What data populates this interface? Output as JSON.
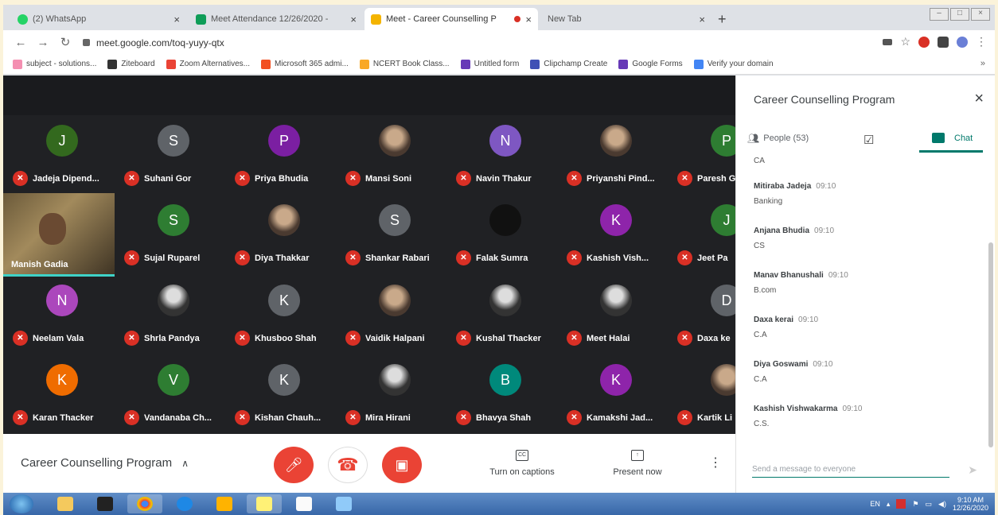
{
  "browser": {
    "tabs": [
      {
        "title": "(2) WhatsApp",
        "favicon_color": "#25d366",
        "active": false
      },
      {
        "title": "Meet Attendance 12/26/2020 - ",
        "favicon_color": "#0f9d58",
        "active": false
      },
      {
        "title": "Meet - Career Counselling P",
        "favicon_color": "#f4b400",
        "active": true
      },
      {
        "title": "New Tab",
        "favicon_color": "",
        "active": false
      }
    ],
    "url": "meet.google.com/toq-yuyy-qtx",
    "bookmarks": [
      {
        "label": "subject - solutions...",
        "color": "#f48fb1"
      },
      {
        "label": "Ziteboard",
        "color": "#333333"
      },
      {
        "label": "Zoom Alternatives...",
        "color": "#ea4335"
      },
      {
        "label": "Microsoft 365 admi...",
        "color": "#f25022"
      },
      {
        "label": "NCERT Book Class...",
        "color": "#f9a825"
      },
      {
        "label": "Untitled form",
        "color": "#673ab7"
      },
      {
        "label": "Clipchamp Create",
        "color": "#3f51b5"
      },
      {
        "label": "Google Forms",
        "color": "#673ab7"
      },
      {
        "label": "Verify your domain",
        "color": "#4285f4"
      }
    ],
    "bookmarks_more": "»"
  },
  "meet": {
    "self_tile": {
      "name": "Manish Gadia"
    },
    "participants": [
      {
        "initial": "J",
        "name": "Jadeja Dipend...",
        "color": "#33691e",
        "style": "letter"
      },
      {
        "initial": "S",
        "name": "Suhani Gor",
        "color": "#5f6368",
        "style": "letter"
      },
      {
        "initial": "P",
        "name": "Priya Bhudia",
        "color": "#7b1fa2",
        "style": "letter"
      },
      {
        "initial": "",
        "name": "Mansi Soni",
        "color": "",
        "style": "photo"
      },
      {
        "initial": "N",
        "name": "Navin Thakur",
        "color": "#7e57c2",
        "style": "letter"
      },
      {
        "initial": "",
        "name": "Priyanshi Pind...",
        "color": "",
        "style": "photo"
      },
      {
        "initial": "P",
        "name": "Paresh G",
        "color": "#2e7d32",
        "style": "letter"
      },
      {
        "initial": "S",
        "name": "Sujal Ruparel",
        "color": "#2e7d32",
        "style": "letter"
      },
      {
        "initial": "",
        "name": "Diya Thakkar",
        "color": "",
        "style": "photo"
      },
      {
        "initial": "S",
        "name": "Shankar Rabari",
        "color": "#5f6368",
        "style": "letter"
      },
      {
        "initial": "",
        "name": "Falak Sumra",
        "color": "",
        "style": "dark"
      },
      {
        "initial": "K",
        "name": "Kashish Vish...",
        "color": "#8e24aa",
        "style": "letter"
      },
      {
        "initial": "J",
        "name": "Jeet Pa",
        "color": "#2e7d32",
        "style": "letter"
      },
      {
        "initial": "N",
        "name": "Neelam Vala",
        "color": "#ab47bc",
        "style": "letter"
      },
      {
        "initial": "",
        "name": "Shrla Pandya",
        "color": "",
        "style": "photo2"
      },
      {
        "initial": "K",
        "name": "Khusboo Shah",
        "color": "#5f6368",
        "style": "letter"
      },
      {
        "initial": "",
        "name": "Vaidik Halpani",
        "color": "",
        "style": "photo"
      },
      {
        "initial": "",
        "name": "Kushal Thacker",
        "color": "",
        "style": "photo2"
      },
      {
        "initial": "",
        "name": "Meet Halai",
        "color": "",
        "style": "photo2"
      },
      {
        "initial": "D",
        "name": "Daxa ke",
        "color": "#5f6368",
        "style": "letter"
      },
      {
        "initial": "K",
        "name": "Karan Thacker",
        "color": "#ef6c00",
        "style": "letter"
      },
      {
        "initial": "V",
        "name": "Vandanaba Ch...",
        "color": "#2e7d32",
        "style": "letter"
      },
      {
        "initial": "K",
        "name": "Kishan Chauh...",
        "color": "#5f6368",
        "style": "letter"
      },
      {
        "initial": "",
        "name": "Mira Hirani",
        "color": "",
        "style": "photo2"
      },
      {
        "initial": "B",
        "name": "Bhavya Shah",
        "color": "#00897b",
        "style": "letter"
      },
      {
        "initial": "K",
        "name": "Kamakshi Jad...",
        "color": "#8e24aa",
        "style": "letter"
      },
      {
        "initial": "",
        "name": "Kartik Li",
        "color": "",
        "style": "photo"
      }
    ],
    "meeting_title": "Career Counselling Program",
    "captions_label": "Turn on captions",
    "present_label": "Present now",
    "accent_red": "#ea4335"
  },
  "panel": {
    "title": "Career Counselling Program",
    "people_label": "People (53)",
    "chat_label": "Chat",
    "partial_top": "CA",
    "messages": [
      {
        "sender": "Mitiraba Jadeja",
        "time": "09:10",
        "body": "Banking"
      },
      {
        "sender": "Anjana Bhudia",
        "time": "09:10",
        "body": "CS"
      },
      {
        "sender": "Manav Bhanushali",
        "time": "09:10",
        "body": "B.com"
      },
      {
        "sender": "Daxa kerai",
        "time": "09:10",
        "body": "C.A"
      },
      {
        "sender": "Diya Goswami",
        "time": "09:10",
        "body": "C.A"
      },
      {
        "sender": "Kashish Vishwakarma",
        "time": "09:10",
        "body": "C.S."
      }
    ],
    "input_placeholder": "Send a message to everyone"
  },
  "taskbar": {
    "lang": "EN",
    "time": "9:10 AM",
    "date": "12/26/2020"
  }
}
